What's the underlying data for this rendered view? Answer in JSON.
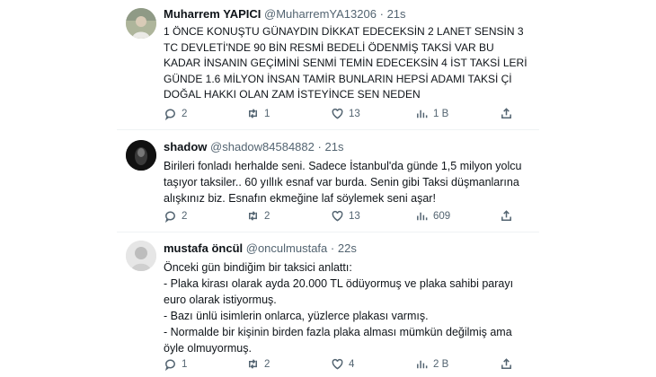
{
  "tweets": [
    {
      "name": "Muharrem YAPICI",
      "handle": "@MuharremYA13206",
      "time": "21s",
      "text": "1  ÖNCE KONUŞTU GÜNAYDIN DİKKAT EDECEKSİN 2 LANET SENSİN 3 TC DEVLETİ'NDE 90 BİN RESMİ BEDELİ ÖDENMİŞ TAKSİ VAR BU KADAR İNSANIN GEÇİMİNİ SENMİ TEMİN EDECEKSİN 4 İST TAKSİ LERİ GÜNDE 1.6 MİLYON İNSAN TAMİR BUNLARIN HEPSİ ADAMI TAKSİ Çİ DOĞAL HAKKI OLAN ZAM İSTEYİNCE SEN NEDEN",
      "replies": "2",
      "retweets": "1",
      "likes": "13",
      "views": "1 B"
    },
    {
      "name": "shadow",
      "handle": "@shadow84584882",
      "time": "21s",
      "text": "Birileri fonladı herhalde  seni. Sadece İstanbul'da günde 1,5 milyon yolcu taşıyor taksiler.. 60 yıllık esnaf  var burda. Senin gibi Taksi düşmanlarına alışkınız biz. Esnafın ekmeğine laf söylemek seni aşar!",
      "replies": "2",
      "retweets": "2",
      "likes": "13",
      "views": "609"
    },
    {
      "name": "mustafa öncül",
      "handle": "@onculmustafa",
      "time": "22s",
      "text": "Önceki gün bindiğim bir taksici anlattı:\n- Plaka kirası olarak ayda 20.000 TL ödüyormuş ve plaka sahibi parayı euro olarak istiyormuş.\n- Bazı ünlü isimlerin onlarca, yüzlerce plakası varmış.\n- Normalde bir kişinin birden fazla plaka alması mümkün değilmiş ama öyle olmuyormuş.",
      "replies": "1",
      "retweets": "2",
      "likes": "4",
      "views": "2 B"
    }
  ]
}
